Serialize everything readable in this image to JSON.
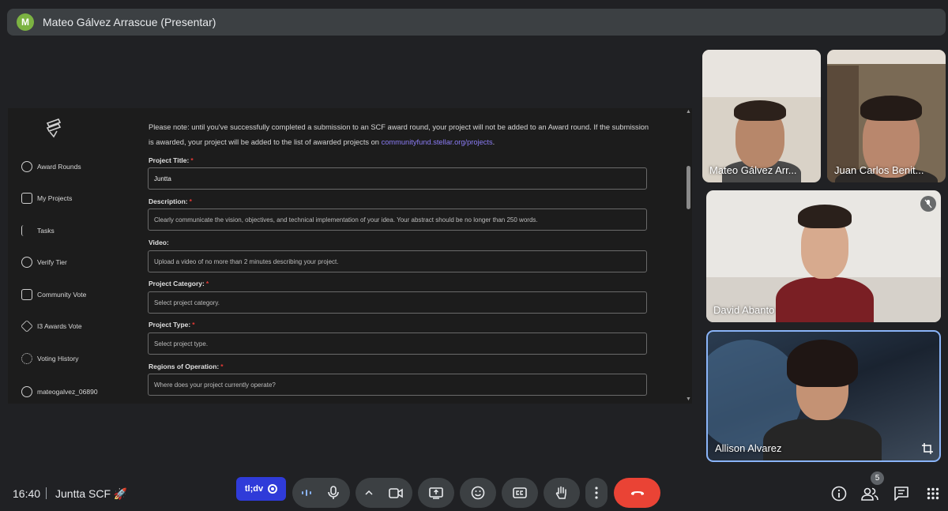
{
  "top_bar": {
    "avatar_initial": "M",
    "title": "Mateo Gálvez Arrascue (Presentar)"
  },
  "shared_screen": {
    "sidebar": {
      "items": [
        {
          "label": "Award Rounds",
          "icon": "award-icon"
        },
        {
          "label": "My Projects",
          "icon": "edit-icon"
        },
        {
          "label": "Tasks",
          "icon": "tasks-icon"
        },
        {
          "label": "Verify Tier",
          "icon": "verify-icon"
        },
        {
          "label": "Community Vote",
          "icon": "mail-icon"
        },
        {
          "label": "I3 Awards Vote",
          "icon": "cube-icon"
        },
        {
          "label": "Voting History",
          "icon": "history-icon"
        },
        {
          "label": "mateogalvez_06890",
          "icon": "user-icon"
        }
      ]
    },
    "note": {
      "text_before": "Please note: until you've successfully completed a submission to an SCF award round, your project will not be added to an Award round. If the submission is awarded, your project will be added to the list of awarded projects on ",
      "link": "communityfund.stellar.org/projects",
      "text_after": "."
    },
    "form": {
      "title_label": "Project Title:",
      "title_required": "*",
      "title_value": "Juntta",
      "description_label": "Description:",
      "description_required": "*",
      "description_placeholder": "Clearly communicate the vision, objectives, and technical implementation of your idea. Your abstract should be no longer than 250 words.",
      "video_label": "Video:",
      "video_placeholder": "Upload a video of no more than 2 minutes describing your project.",
      "category_label": "Project Category:",
      "category_required": "*",
      "category_placeholder": "Select project category.",
      "type_label": "Project Type:",
      "type_required": "*",
      "type_placeholder": "Select project type.",
      "regions_label": "Regions of Operation:",
      "regions_required": "*",
      "regions_placeholder": "Where does your project currently operate?"
    }
  },
  "participants": [
    {
      "name": "Mateo Gálvez Arr..."
    },
    {
      "name": "Juan Carlos Benit..."
    },
    {
      "name": "David Abanto",
      "muted": true
    },
    {
      "name": "Allison Alvarez",
      "active_speaker": true
    }
  ],
  "bottom_bar": {
    "time": "16:40",
    "meeting_name": "Juntta SCF 🚀",
    "tldv_label": "tl;dv",
    "people_count": "5",
    "colors": {
      "hangup": "#ea4335",
      "tldv": "#2f3bd9",
      "active_border": "#8ab4f8"
    }
  }
}
